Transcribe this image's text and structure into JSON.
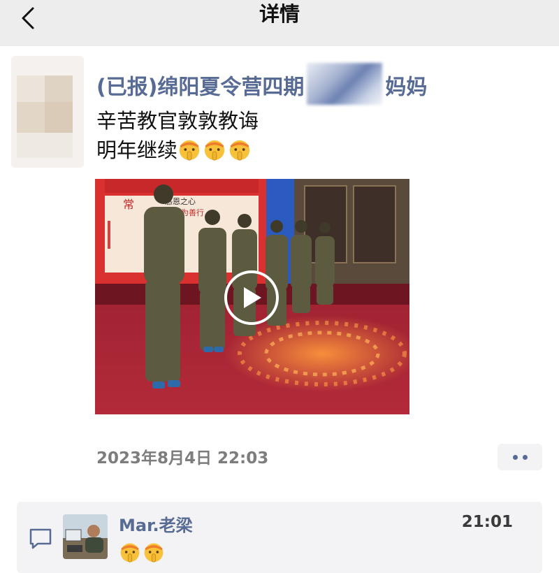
{
  "nav": {
    "title": "详情"
  },
  "post": {
    "poster_prefix": "(已报)绵阳夏令营四期",
    "poster_suffix": "妈妈",
    "text_line1": "辛苦教官敦敦教诲",
    "text_line2": "明年继续",
    "text_line2_emojis": [
      "shushing-face-emoji",
      "shushing-face-emoji",
      "shushing-face-emoji"
    ],
    "timestamp": "2023年8月4日 22:03",
    "video": {
      "banner_text_1": "常",
      "banner_text_2": "感恩之心",
      "banner_text_3": "常为善行"
    }
  },
  "comment": {
    "name": "Mar.老梁",
    "time": "21:01",
    "emojis": [
      "shushing-face-emoji",
      "shushing-face-emoji"
    ]
  },
  "colors": {
    "link": "#576b95",
    "topbar": "#ededed",
    "comment_bg": "#f3f3f5"
  }
}
